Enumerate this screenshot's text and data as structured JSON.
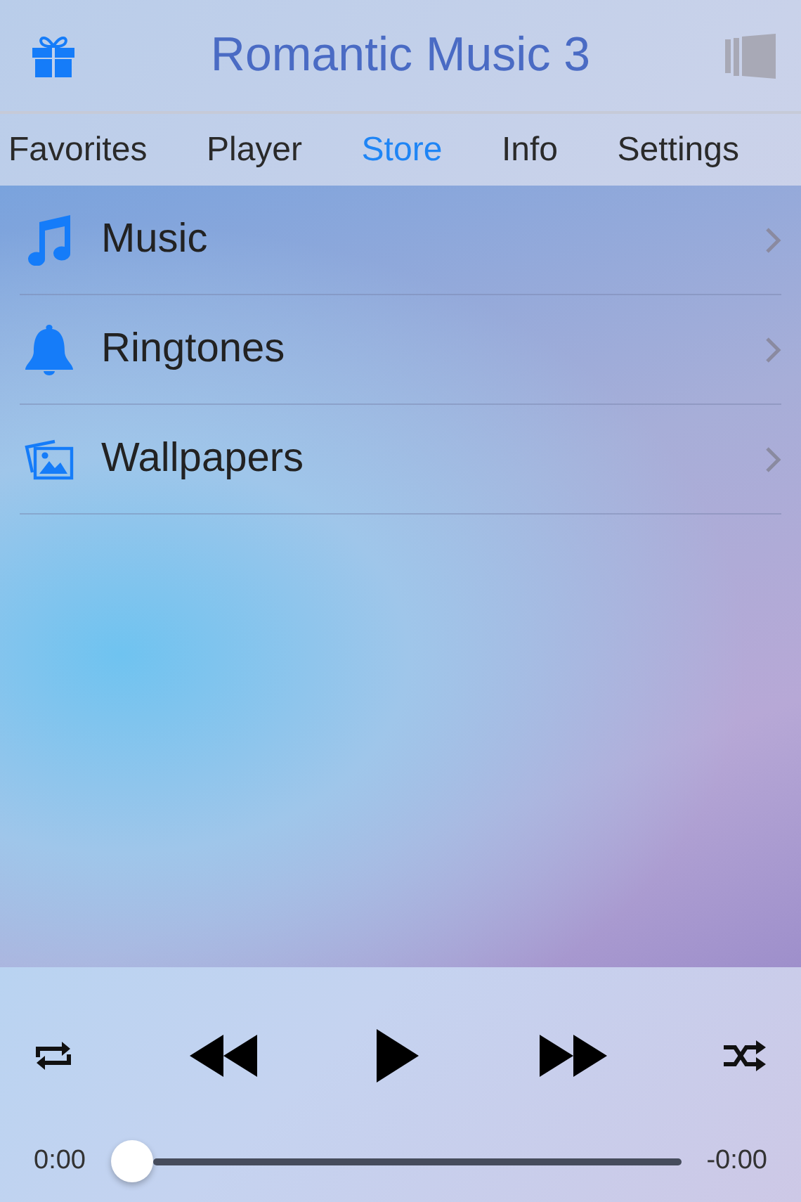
{
  "header": {
    "title": "Romantic Music 3"
  },
  "tabs": [
    {
      "label": "Favorites",
      "selected": false
    },
    {
      "label": "Player",
      "selected": false
    },
    {
      "label": "Store",
      "selected": true
    },
    {
      "label": "Info",
      "selected": false
    },
    {
      "label": "Settings",
      "selected": false
    }
  ],
  "store_items": [
    {
      "label": "Music"
    },
    {
      "label": "Ringtones"
    },
    {
      "label": "Wallpapers"
    }
  ],
  "player": {
    "elapsed": "0:00",
    "remaining": "-0:00",
    "progress": {
      "level": 0
    }
  }
}
